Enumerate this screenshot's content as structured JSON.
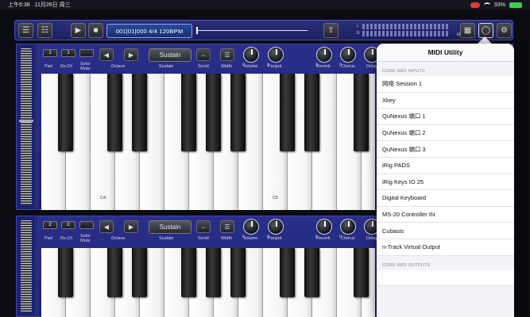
{
  "status": {
    "time": "上午6:38",
    "date": "11月26日 周三",
    "battery": "93%"
  },
  "toolbar": {
    "position_display": "001|01|000 4/4 120BPM",
    "meter_left_label": "L",
    "meter_right_label": "R",
    "midi_label": "MIDI"
  },
  "keyboards": [
    {
      "part": "1",
      "rx_ch": "1",
      "sustain_label": "Sustain",
      "labels": {
        "part": "Part",
        "rx_ch": "Rx.Ch",
        "solo_mute": "Solo/\nMute",
        "octave": "Octave",
        "sustain": "Sustain",
        "scroll": "Scroll",
        "width": "Width",
        "volume": "Volume",
        "panpot": "Panpot",
        "reverb": "Reverb",
        "chorus": "Chorus",
        "delay": "Delay"
      },
      "key_labels": [
        "C4",
        "C5"
      ]
    },
    {
      "part": "2",
      "rx_ch": "2",
      "sustain_label": "Sustain",
      "labels": {
        "part": "Part",
        "rx_ch": "Rx.Ch",
        "solo_mute": "Solo/\nMute",
        "octave": "Octave",
        "sustain": "Sustain",
        "scroll": "Scroll",
        "width": "Width",
        "volume": "Volume",
        "panpot": "Panpot",
        "reverb": "Reverb",
        "chorus": "Chorus",
        "delay": "Delay"
      },
      "key_labels": []
    }
  ],
  "knob_value": "0",
  "midi_utility": {
    "title": "MIDI Utility",
    "inputs_header": "CORE MIDI INPUTS",
    "inputs": [
      "网络 Session 1",
      "Xkey",
      "QuNexus 端口 1",
      "QuNexus 端口 2",
      "QuNexus 端口 3",
      "iRig PADS",
      "iRig Keys IO 25",
      "Digital Keyboard",
      "MS-20 Controller IN",
      "Cubasis",
      "n-Track Virtual Output"
    ],
    "outputs_header": "CORE MIDI OUTPUTS"
  },
  "colors": {
    "panel_blue": "#2a2f8a",
    "popover_bg": "#f2f2f7",
    "battery_green": "#3ccf4e",
    "mic_red": "#e53935"
  }
}
